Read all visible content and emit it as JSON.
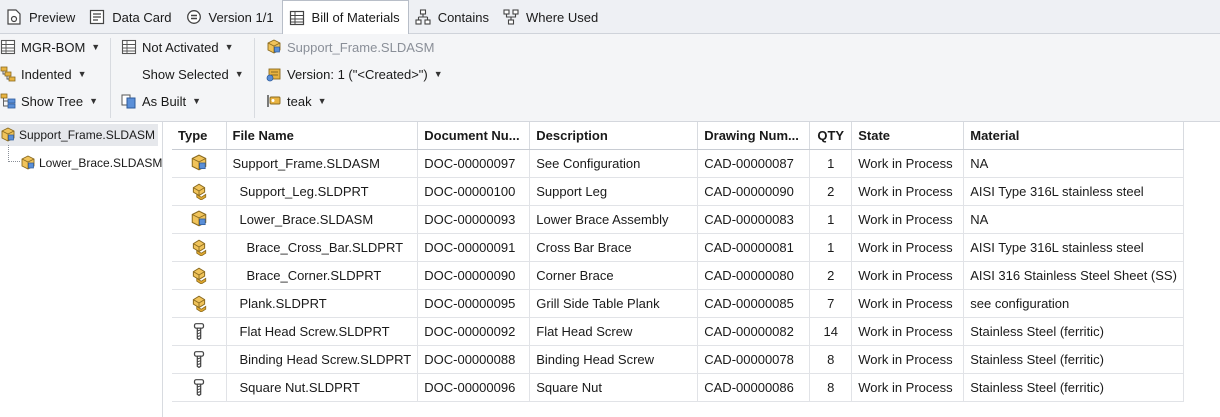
{
  "tabs": [
    {
      "label": "Preview",
      "icon": "preview-icon",
      "active": false
    },
    {
      "label": "Data Card",
      "icon": "data-card-icon",
      "active": false
    },
    {
      "label": "Version 1/1",
      "icon": "version-icon",
      "active": false
    },
    {
      "label": "Bill of Materials",
      "icon": "bom-icon",
      "active": true
    },
    {
      "label": "Contains",
      "icon": "contains-icon",
      "active": false
    },
    {
      "label": "Where Used",
      "icon": "where-used-icon",
      "active": false
    }
  ],
  "toolbar": {
    "bom_name": "MGR-BOM",
    "view_mode": "Indented",
    "show_tree": "Show Tree",
    "activation": "Not Activated",
    "show_selected": "Show Selected",
    "as_built": "As Built",
    "file_name": "Support_Frame.SLDASM",
    "version": "Version: 1 (\"<Created>\")",
    "user": "teak"
  },
  "tree": {
    "root": "Support_Frame.SLDASM",
    "child": "Lower_Brace.SLDASM"
  },
  "grid": {
    "columns": [
      "Type",
      "File Name",
      "Document Nu...",
      "Description",
      "Drawing Num...",
      "QTY",
      "State",
      "Material"
    ],
    "rows": [
      {
        "type": "assembly",
        "file": "Support_Frame.SLDASM",
        "doc": "DOC-00000097",
        "desc": "See Configuration",
        "drawing": "CAD-00000087",
        "qty": "1",
        "state": "Work in Process",
        "material": "NA"
      },
      {
        "type": "part",
        "file": "Support_Leg.SLDPRT",
        "doc": "DOC-00000100",
        "desc": "Support Leg",
        "drawing": "CAD-00000090",
        "qty": "2",
        "state": "Work in Process",
        "material": "AISI Type 316L stainless steel"
      },
      {
        "type": "assembly",
        "file": "Lower_Brace.SLDASM",
        "doc": "DOC-00000093",
        "desc": "Lower Brace Assembly",
        "drawing": "CAD-00000083",
        "qty": "1",
        "state": "Work in Process",
        "material": "NA"
      },
      {
        "type": "part",
        "file": "Brace_Cross_Bar.SLDPRT",
        "doc": "DOC-00000091",
        "desc": "Cross Bar Brace",
        "drawing": "CAD-00000081",
        "qty": "1",
        "state": "Work in Process",
        "material": "AISI Type 316L stainless steel"
      },
      {
        "type": "part",
        "file": "Brace_Corner.SLDPRT",
        "doc": "DOC-00000090",
        "desc": "Corner Brace",
        "drawing": "CAD-00000080",
        "qty": "2",
        "state": "Work in Process",
        "material": "AISI 316 Stainless Steel Sheet (SS)"
      },
      {
        "type": "part",
        "file": "Plank.SLDPRT",
        "doc": "DOC-00000095",
        "desc": "Grill Side Table Plank",
        "drawing": "CAD-00000085",
        "qty": "7",
        "state": "Work in Process",
        "material": "see configuration"
      },
      {
        "type": "toolbox",
        "file": "Flat Head Screw.SLDPRT",
        "doc": "DOC-00000092",
        "desc": "Flat Head Screw",
        "drawing": "CAD-00000082",
        "qty": "14",
        "state": "Work in Process",
        "material": "Stainless Steel (ferritic)"
      },
      {
        "type": "toolbox",
        "file": "Binding Head Screw.SLDPRT",
        "doc": "DOC-00000088",
        "desc": "Binding Head Screw",
        "drawing": "CAD-00000078",
        "qty": "8",
        "state": "Work in Process",
        "material": "Stainless Steel (ferritic)"
      },
      {
        "type": "toolbox",
        "file": "Square Nut.SLDPRT",
        "doc": "DOC-00000096",
        "desc": "Square Nut",
        "drawing": "CAD-00000086",
        "qty": "8",
        "state": "Work in Process",
        "material": "Stainless Steel (ferritic)"
      }
    ]
  }
}
